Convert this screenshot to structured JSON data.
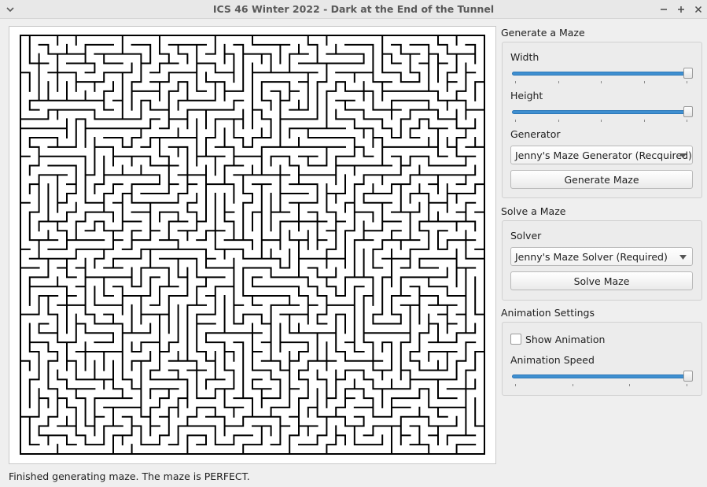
{
  "window": {
    "title": "ICS 46 Winter 2022 - Dark at the End of the Tunnel"
  },
  "generate_group": {
    "title": "Generate a Maze",
    "width_label": "Width",
    "width_value_fraction": 1.0,
    "height_label": "Height",
    "height_value_fraction": 1.0,
    "generator_label": "Generator",
    "generator_selected": "Jenny's Maze Generator (Recquired)",
    "generate_button": "Generate Maze"
  },
  "solve_group": {
    "title": "Solve a Maze",
    "solver_label": "Solver",
    "solver_selected": "Jenny's Maze Solver (Required)",
    "solve_button": "Solve Maze"
  },
  "animation_group": {
    "title": "Animation Settings",
    "show_animation_label": "Show Animation",
    "show_animation_checked": false,
    "speed_label": "Animation Speed",
    "speed_value_fraction": 1.0
  },
  "status": {
    "message": "Finished generating maze.  The maze is PERFECT."
  },
  "colors": {
    "accent": "#3f8fd0",
    "maze_wall": "#000000",
    "maze_background": "#ffffff"
  }
}
